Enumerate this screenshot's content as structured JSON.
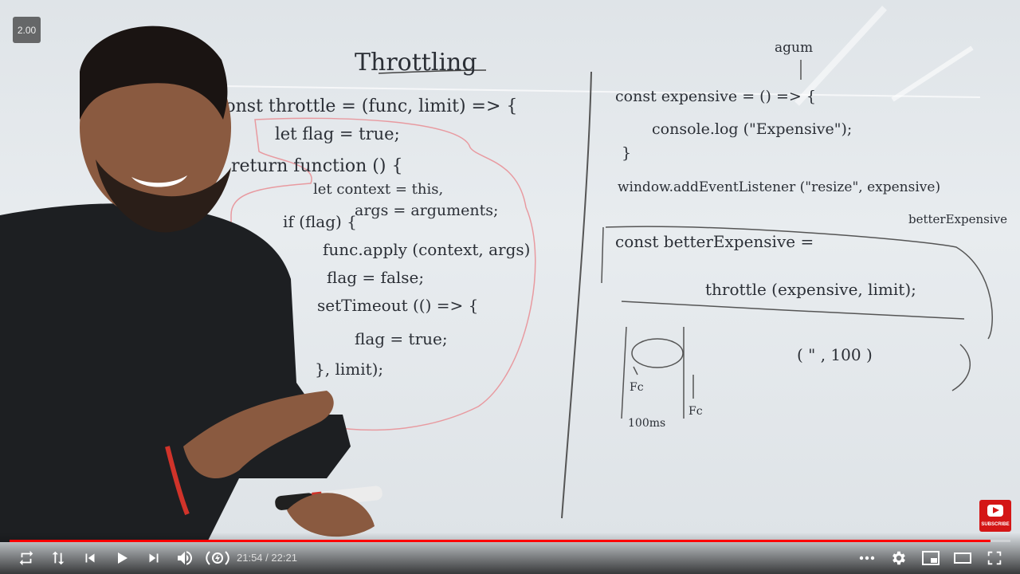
{
  "player": {
    "speed": "2.00",
    "time_current": "21:54",
    "time_total": "22:21",
    "progress_fraction": 0.98,
    "subscribe_label": "SUBSCRIBE",
    "accent_color": "#ff0000"
  },
  "whiteboard": {
    "title": "Throttling",
    "left_code": [
      "const throttle = (func, limit) => {",
      "let flag = true;",
      "return function () {",
      "let context = this,",
      "args = arguments;",
      "if (flag) {",
      "func.apply (context, args)",
      "flag = false;",
      "setTimeout (() => {",
      "flag = true;",
      "}, limit);"
    ],
    "right_code": [
      "agum",
      "const expensive = () => {",
      "console.log (\"Expensive\");",
      "}",
      "window.addEventListener (\"resize\", expensive)",
      "betterExpensive",
      "const betterExpensive =",
      "throttle (expensive, limit);",
      "( \" , 100 )",
      "Fc",
      "Fc",
      "100ms"
    ]
  },
  "icons": [
    "loop-icon",
    "sort-icon",
    "previous-icon",
    "play-icon",
    "next-icon",
    "volume-icon",
    "autoplay-icon",
    "more-icon",
    "settings-icon",
    "miniplayer-icon",
    "theater-icon",
    "fullscreen-icon"
  ]
}
